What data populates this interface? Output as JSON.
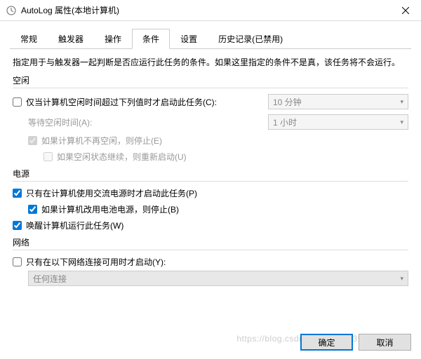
{
  "window": {
    "title": "AutoLog 属性(本地计算机)"
  },
  "tabs": [
    "常规",
    "触发器",
    "操作",
    "条件",
    "设置",
    "历史记录(已禁用)"
  ],
  "active_tab": "条件",
  "description": "指定用于与触发器一起判断是否应运行此任务的条件。如果这里指定的条件不是真，该任务将不会运行。",
  "idle": {
    "section": "空闲",
    "start_if_idle": "仅当计算机空闲时间超过下列值时才启动此任务(C):",
    "start_if_idle_checked": false,
    "idle_duration": "10 分钟",
    "wait_label": "等待空闲时间(A):",
    "wait_duration": "1 小时",
    "stop_if_not_idle": "如果计算机不再空闲，则停止(E)",
    "stop_if_not_idle_checked": true,
    "restart_on_idle": "如果空闲状态继续，则重新启动(U)",
    "restart_on_idle_checked": false
  },
  "power": {
    "section": "电源",
    "ac_only": "只有在计算机使用交流电源时才启动此任务(P)",
    "ac_only_checked": true,
    "stop_on_battery": "如果计算机改用电池电源，则停止(B)",
    "stop_on_battery_checked": true,
    "wake": "唤醒计算机运行此任务(W)",
    "wake_checked": true
  },
  "network": {
    "section": "网络",
    "only_if_network": "只有在以下网络连接可用时才启动(Y):",
    "only_if_network_checked": false,
    "connection": "任何连接"
  },
  "buttons": {
    "ok": "确定",
    "cancel": "取消"
  },
  "watermark": "https://blog.csdn.net/weixin_39936086"
}
